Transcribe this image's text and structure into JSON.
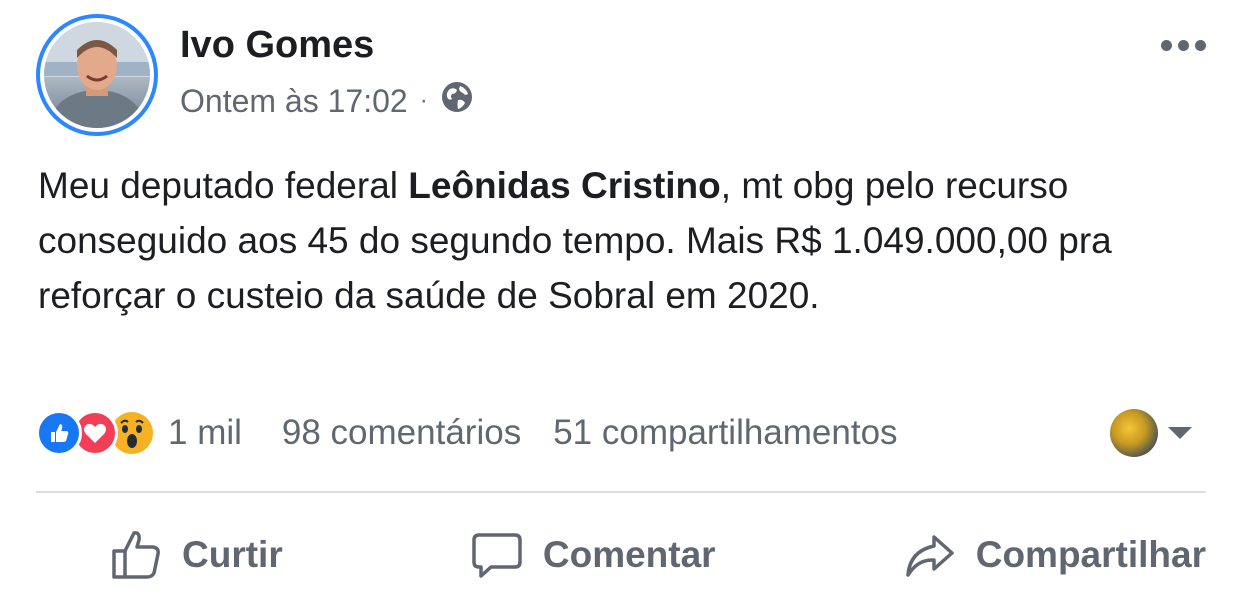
{
  "post": {
    "author": "Ivo Gomes",
    "timestamp": "Ontem às 17:02",
    "separator": "·",
    "privacy_icon": "globe-icon",
    "text_before": "Meu deputado federal ",
    "text_bold": "Leônidas Cristino",
    "text_after": ", mt obg pelo recurso conseguido aos 45 do segundo tempo. Mais R$ 1.049.000,00 pra reforçar o custeio da saúde de Sobral em 2020."
  },
  "reactions": {
    "icons": [
      "like-reaction-icon",
      "love-reaction-icon",
      "wow-reaction-icon"
    ],
    "count": "1 mil",
    "comments": "98 comentários",
    "shares": "51 compartilhamentos"
  },
  "actions": {
    "like_label": "Curtir",
    "comment_label": "Comentar",
    "share_label": "Compartilhar"
  },
  "colors": {
    "accent": "#2d88ff",
    "like": "#1877f2",
    "love": "#f33e58",
    "wow": "#f7b125",
    "secondary_text": "#606770"
  }
}
